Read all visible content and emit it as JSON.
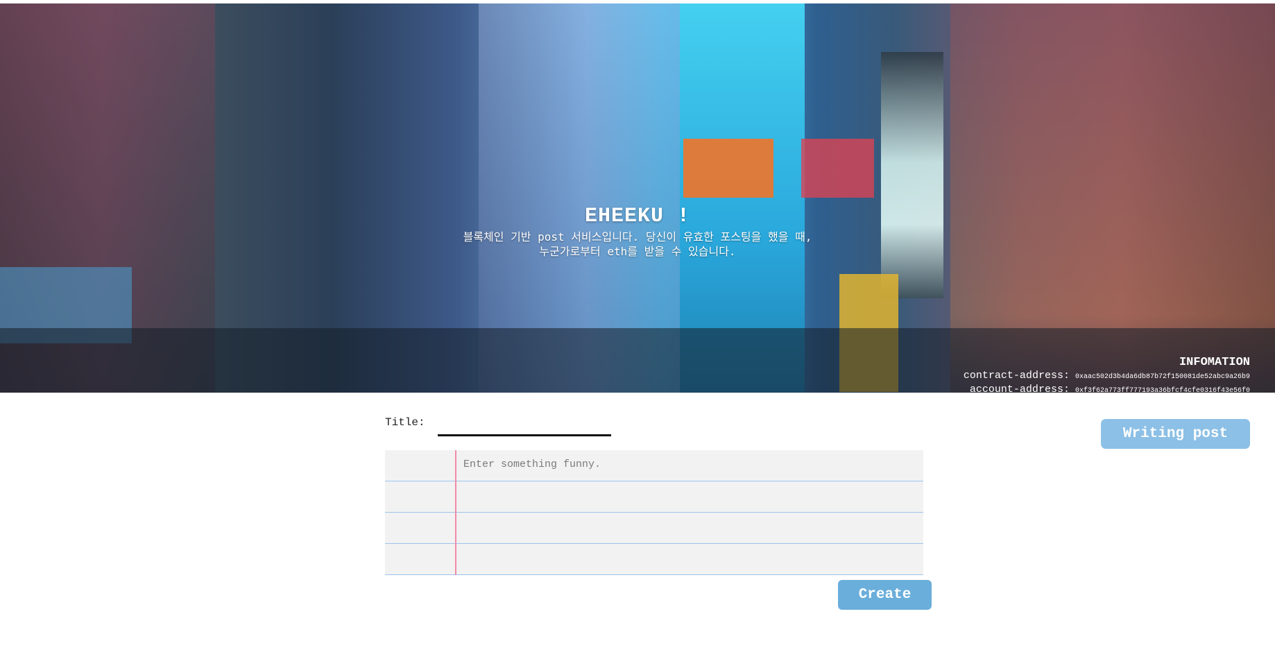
{
  "header": {
    "title": "EHEEKU !",
    "subtitle_line1": "블록체인 기반 post 서비스입니다. 당신이 유효한 포스팅을 했을 때,",
    "subtitle_line2": "누군가로부터 eth를 받을 수 있습니다."
  },
  "info": {
    "heading": "INFOMATION",
    "contract_label": "contract-address:",
    "contract_address": "0xaac502d3b4da6db87b72f150081de52abc9a26b9",
    "account_label": "account-address:",
    "account_address": "0xf3f62a773ff777193a36bfcf4cfe0316f43e56f0"
  },
  "form": {
    "title_label": "Title:",
    "title_value": "",
    "body_placeholder": "Enter something funny.",
    "create_label": "Create"
  },
  "actions": {
    "writing_post_label": "Writing post"
  },
  "colors": {
    "button_blue": "#6aaedb",
    "button_light_blue": "#8cc0e6",
    "paper_line": "#9cc4ee",
    "paper_margin": "#f08aa6"
  }
}
